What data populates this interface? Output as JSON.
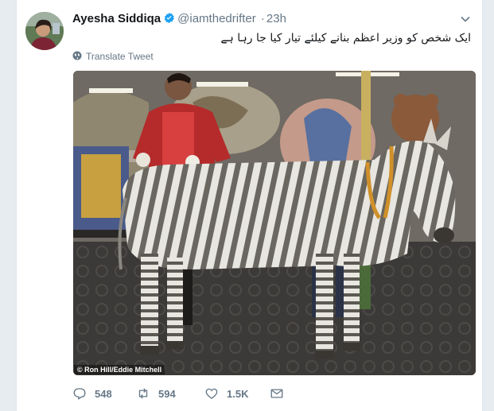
{
  "tweet": {
    "author_name": "Ayesha Siddiqa",
    "handle": "@iamthedrifter",
    "separator": "·",
    "time": "23h",
    "text": "ایک شخص کو وزیر اعظم بنانے کیلئے تیار کیا جا رہا ہے",
    "translate_label": "Translate Tweet",
    "media_credit": "© Ron Hill/Eddie Mitchell",
    "verified": true
  },
  "actions": {
    "reply_count": "548",
    "retweet_count": "594",
    "like_count": "1.5K"
  },
  "colors": {
    "text_primary": "#14171a",
    "text_secondary": "#657786",
    "verified_blue": "#1da1f2",
    "page_bg": "#e6ecf0"
  },
  "icons": [
    "verified-badge-icon",
    "chevron-down-icon",
    "globe-icon",
    "reply-icon",
    "retweet-icon",
    "like-icon",
    "message-icon"
  ]
}
